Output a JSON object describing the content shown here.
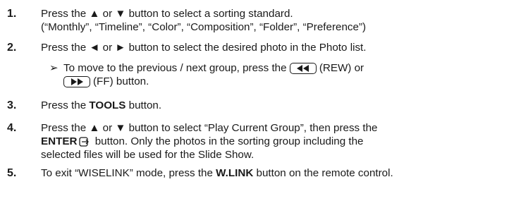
{
  "steps": [
    {
      "number": "1.",
      "line1": "Press the ▲ or ▼ button to select a sorting standard.",
      "line2": "(“Monthly”, “Timeline”, “Color”, “Composition”, “Folder”, “Preference”)"
    },
    {
      "number": "2.",
      "line1": "Press the ◄ or ► button to select the desired photo in the Photo list.",
      "note_arrow": "➢",
      "note_line1_a": "To move to the previous / next group, press the",
      "note_rew_label": "(REW) or",
      "note_ff_label": "(FF) button."
    },
    {
      "number": "3.",
      "pre": "Press the ",
      "bold": "TOOLS",
      "post": " button."
    },
    {
      "number": "4.",
      "line1": "Press the ▲ or ▼ button to select “Play Current Group”, then press the",
      "line2_bold": "ENTER",
      "line2_post": " button. Only the photos in the sorting group including the",
      "line3": "selected files will be used for the Slide Show."
    },
    {
      "number": "5.",
      "pre": "To exit “WISELINK” mode, press the ",
      "bold": "W.LINK",
      "post": " button on the remote control."
    }
  ],
  "icons": {
    "rew": "rewind-icon",
    "ff": "fast-forward-icon",
    "enter": "enter-icon"
  }
}
